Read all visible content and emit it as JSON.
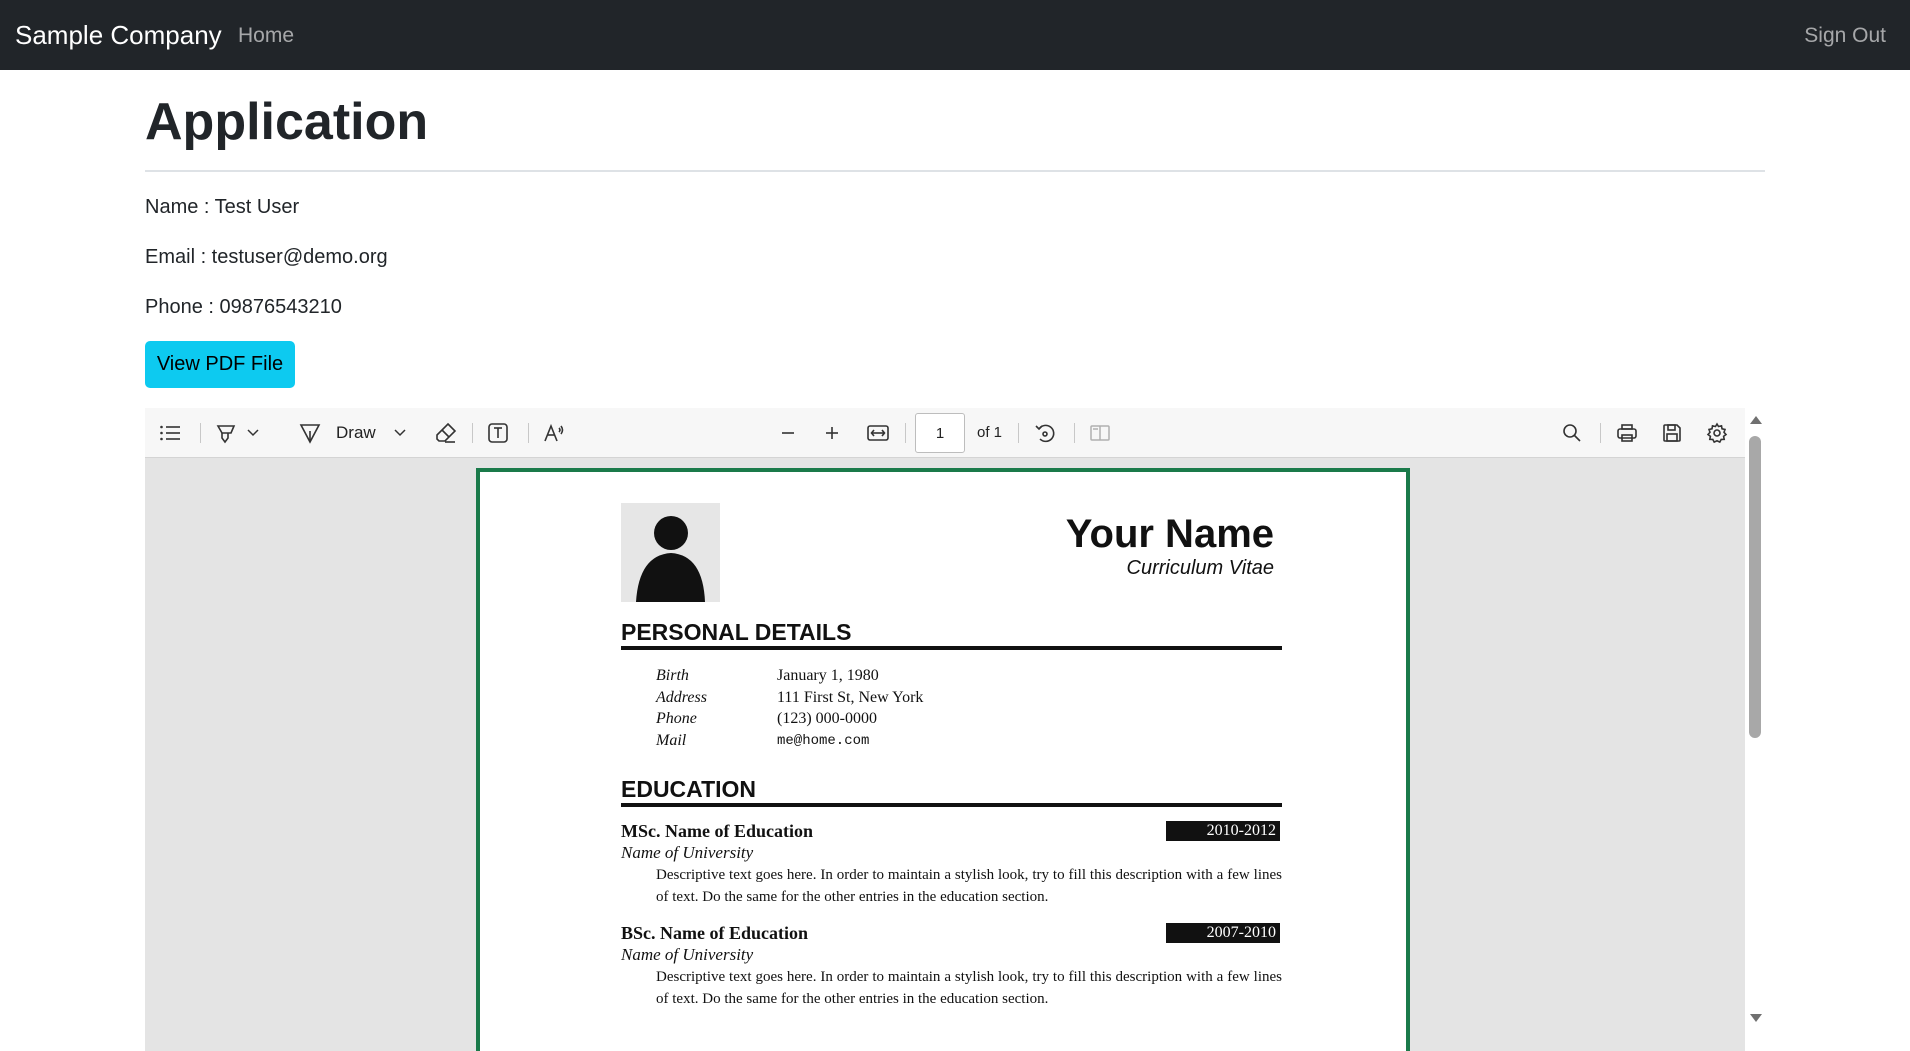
{
  "navbar": {
    "brand": "Sample Company",
    "home": "Home",
    "sign_out": "Sign Out"
  },
  "page": {
    "title": "Application",
    "name_line": "Name : Test User",
    "email_line": "Email : testuser@demo.org",
    "phone_line": "Phone : 09876543210",
    "view_button": "View PDF File"
  },
  "viewer": {
    "toolbar": {
      "draw_label": "Draw",
      "page_number": "1",
      "page_of": "of 1"
    },
    "document": {
      "name": "Your Name",
      "subtitle": "Curriculum Vitae",
      "personal_heading": "PERSONAL DETAILS",
      "personal": [
        {
          "label": "Birth",
          "value": "January 1, 1980"
        },
        {
          "label": "Address",
          "value": "111 First St, New York"
        },
        {
          "label": "Phone",
          "value": "(123) 000-0000"
        },
        {
          "label": "Mail",
          "value": "me@home.com"
        }
      ],
      "education_heading": "EDUCATION",
      "education": [
        {
          "degree": "MSc. Name of Education",
          "dates": "2010-2012",
          "university": "Name of University",
          "description": "Descriptive text goes here. In order to maintain a stylish look, try to fill this description with a few lines of text. Do the same for the other entries in the education section."
        },
        {
          "degree": "BSc. Name of Education",
          "dates": "2007-2010",
          "university": "Name of University",
          "description": "Descriptive text goes here. In order to maintain a stylish look, try to fill this description with a few lines of text. Do the same for the other entries in the education section."
        }
      ]
    }
  },
  "colors": {
    "navbar_bg": "#212529",
    "button_bg": "#0dcaf0",
    "pdf_border": "#1a7a4a",
    "viewer_bg": "#e4e4e4"
  },
  "icons": [
    "list-icon",
    "highlight-icon",
    "chevron-down-icon",
    "draw-pen-icon",
    "eraser-icon",
    "text-box-icon",
    "read-aloud-icon",
    "zoom-out-icon",
    "zoom-in-icon",
    "fit-width-icon",
    "rotate-icon",
    "page-view-icon",
    "search-icon",
    "print-icon",
    "save-icon",
    "settings-gear-icon"
  ]
}
